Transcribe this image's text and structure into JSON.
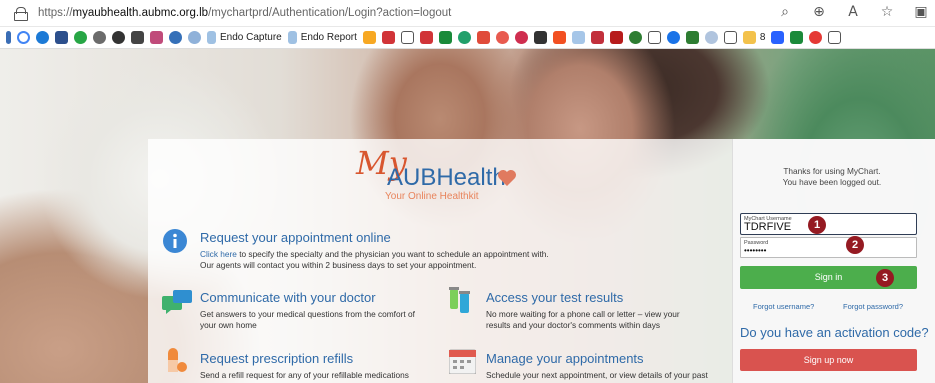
{
  "browser": {
    "url_prefix": "https://",
    "url_host": "myaubhealth.aubmc.org.lb",
    "url_path": "/mychartprd/Authentication/Login?action=logout"
  },
  "bookmarks": {
    "endo_capture": "Endo Capture",
    "endo_report": "Endo Report",
    "folder_count": "8"
  },
  "logo": {
    "my": "My",
    "brand": "AUBHealth",
    "tagline": "Your Online Healthkit"
  },
  "features": {
    "appointment": {
      "title": "Request your appointment online",
      "link": "Click here",
      "desc_line1": " to specify the specialty and the physician you want to schedule an appointment with.",
      "desc_line2": "Our agents will contact you within 2 business days to set your appointment."
    },
    "communicate": {
      "title": "Communicate with your doctor",
      "desc_line1": "Get answers to your medical questions from the comfort of",
      "desc_line2": "your own home"
    },
    "results": {
      "title": "Access your test results",
      "desc_line1": "No more waiting for a phone call or letter – view your",
      "desc_line2": "results and your doctor's comments within days"
    },
    "refills": {
      "title": "Request prescription refills",
      "desc_line1": "Send a refill request for any of your refillable medications"
    },
    "manage": {
      "title": "Manage your appointments",
      "desc_line1": "Schedule your next appointment, or view details of your past"
    }
  },
  "login": {
    "thanks_line1": "Thanks for using MyChart.",
    "thanks_line2": "You have been logged out.",
    "username_label": "MyChart Username",
    "username_value": "TDRFIVE",
    "password_label": "Password",
    "password_value": "••••••••",
    "signin_label": "Sign in",
    "forgot_username": "Forgot username?",
    "forgot_password": "Forgot password?",
    "activation": "Do you have an activation code?",
    "signup_label": "Sign up now"
  },
  "annotations": {
    "badge1": "1",
    "badge2": "2",
    "badge3": "3"
  },
  "colors": {
    "accent_blue": "#2f6aa8",
    "signin_green": "#4cae4c",
    "signup_red": "#d9534f",
    "badge_red": "#951a22",
    "logo_orange": "#d8562f"
  }
}
